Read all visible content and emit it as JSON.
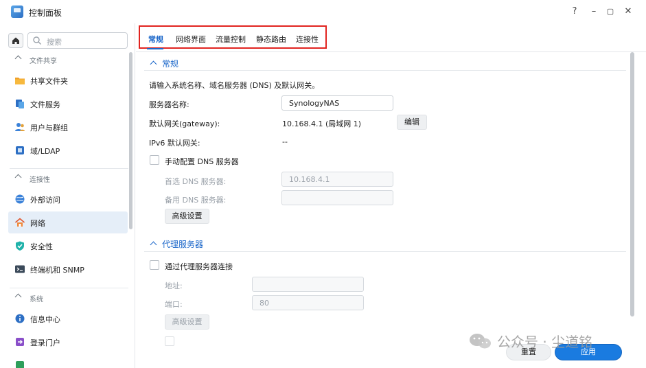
{
  "window": {
    "title": "控制面板",
    "help_label": "?",
    "minimize_label": "–",
    "maximize_label": "▢",
    "close_label": "✕"
  },
  "sidebar": {
    "search_placeholder": "搜索",
    "sections": [
      {
        "label": "文件共享",
        "items": [
          {
            "label": "共享文件夹",
            "icon": "folder-icon"
          },
          {
            "label": "文件服务",
            "icon": "file-services-icon"
          },
          {
            "label": "用户与群组",
            "icon": "users-icon"
          },
          {
            "label": "域/LDAP",
            "icon": "domain-icon"
          }
        ]
      },
      {
        "label": "连接性",
        "items": [
          {
            "label": "外部访问",
            "icon": "globe-icon"
          },
          {
            "label": "网络",
            "icon": "network-home-icon",
            "active": true
          },
          {
            "label": "安全性",
            "icon": "shield-icon"
          },
          {
            "label": "终端机和 SNMP",
            "icon": "terminal-icon"
          }
        ]
      },
      {
        "label": "系统",
        "items": [
          {
            "label": "信息中心",
            "icon": "info-icon"
          },
          {
            "label": "登录门户",
            "icon": "login-portal-icon"
          }
        ]
      }
    ]
  },
  "tabs": [
    {
      "label": "常规",
      "active": true
    },
    {
      "label": "网络界面"
    },
    {
      "label": "流量控制"
    },
    {
      "label": "静态路由"
    },
    {
      "label": "连接性"
    }
  ],
  "general": {
    "title": "常规",
    "description": "请输入系统名称、域名服务器 (DNS) 及默认网关。",
    "server_name_label": "服务器名称:",
    "server_name_value": "SynologyNAS",
    "gateway_label": "默认网关(gateway):",
    "gateway_value": "10.168.4.1 (局域网 1)",
    "edit_button": "编辑",
    "ipv6_gateway_label": "IPv6 默认网关:",
    "ipv6_gateway_value": "--",
    "manual_dns_label": "手动配置 DNS 服务器",
    "primary_dns_label": "首选 DNS 服务器:",
    "primary_dns_value": "10.168.4.1",
    "secondary_dns_label": "备用 DNS 服务器:",
    "secondary_dns_value": "",
    "advanced_button": "高级设置"
  },
  "proxy": {
    "title": "代理服务器",
    "connect_label": "通过代理服务器连接",
    "address_label": "地址:",
    "address_value": "",
    "port_label": "端口:",
    "port_value": "80",
    "advanced_button": "高级设置"
  },
  "footer": {
    "reset_button": "重置",
    "apply_button": "应用"
  },
  "watermark": {
    "text": "公众号 · 尘道铭"
  },
  "colors": {
    "accent": "#1a66c9",
    "apply": "#1a7be0",
    "highlight_box": "#e1231f"
  }
}
